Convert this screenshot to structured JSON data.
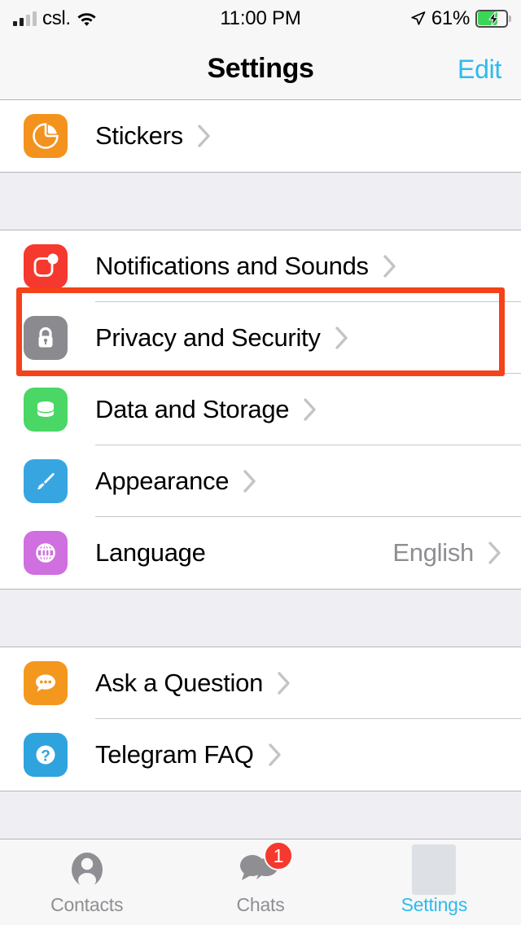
{
  "status_bar": {
    "carrier": "csl.",
    "signal_icon": "cellular-signal-icon",
    "wifi_icon": "wifi-icon",
    "time": "11:00 PM",
    "location_icon": "location-arrow-icon",
    "battery_percent": "61%",
    "battery_icon": "battery-charging-icon",
    "battery_level": 61
  },
  "nav": {
    "title": "Settings",
    "edit_label": "Edit"
  },
  "sections": [
    {
      "id": "stickers-section",
      "rows": [
        {
          "id": "stickers",
          "label": "Stickers",
          "icon": "sticker-icon",
          "icon_class": "ic-stickers",
          "value": "",
          "chevron": true
        }
      ]
    },
    {
      "id": "preferences-section",
      "rows": [
        {
          "id": "notifications-and-sounds",
          "label": "Notifications and Sounds",
          "icon": "notification-bell-icon",
          "icon_class": "ic-notif",
          "value": "",
          "chevron": true
        },
        {
          "id": "privacy-and-security",
          "label": "Privacy and Security",
          "icon": "lock-icon",
          "icon_class": "ic-privacy",
          "value": "",
          "chevron": true,
          "highlighted": true
        },
        {
          "id": "data-and-storage",
          "label": "Data and Storage",
          "icon": "database-icon",
          "icon_class": "ic-data",
          "value": "",
          "chevron": true
        },
        {
          "id": "appearance",
          "label": "Appearance",
          "icon": "paintbrush-icon",
          "icon_class": "ic-appear",
          "value": "",
          "chevron": true
        },
        {
          "id": "language",
          "label": "Language",
          "icon": "globe-icon",
          "icon_class": "ic-lang",
          "value": "English",
          "chevron": true
        }
      ]
    },
    {
      "id": "help-section",
      "rows": [
        {
          "id": "ask-a-question",
          "label": "Ask a Question",
          "icon": "chat-bubble-icon",
          "icon_class": "ic-ask",
          "value": "",
          "chevron": true
        },
        {
          "id": "telegram-faq",
          "label": "Telegram FAQ",
          "icon": "question-mark-icon",
          "icon_class": "ic-faq",
          "value": "",
          "chevron": true
        }
      ]
    }
  ],
  "tab_bar": {
    "tabs": [
      {
        "id": "contacts",
        "label": "Contacts",
        "icon": "person-icon",
        "active": false,
        "badge": ""
      },
      {
        "id": "chats",
        "label": "Chats",
        "icon": "chat-bubbles-icon",
        "active": false,
        "badge": "1"
      },
      {
        "id": "settings",
        "label": "Settings",
        "icon": "settings-gear-icon",
        "active": true,
        "badge": ""
      }
    ]
  },
  "colors": {
    "accent": "#2cbbef",
    "highlight_box": "#f4421a",
    "badge": "#f5392e",
    "group_background": "#efeef3",
    "row_background": "#ffffff",
    "secondary_text": "#8e8e93"
  }
}
